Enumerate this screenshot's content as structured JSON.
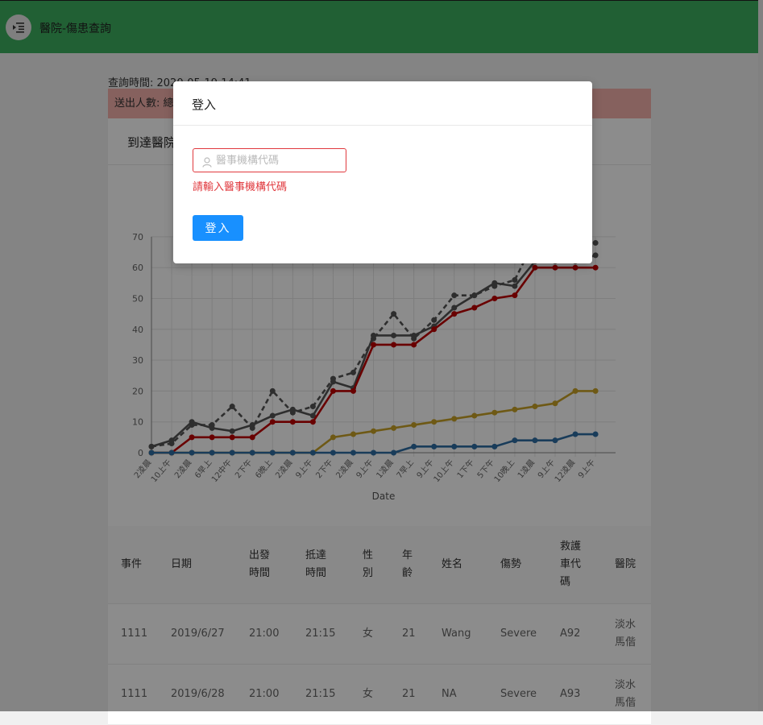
{
  "header": {
    "title": "醫院-傷患查詢",
    "menu_icon": "menu-fold-icon"
  },
  "query_time": "查詢時間: 2020-05-19 14:41",
  "banner": {
    "text": "送出人數: 總",
    "color": "#f5b1ab"
  },
  "card": {
    "title": "到達醫院"
  },
  "chart_data": {
    "type": "line",
    "xlabel": "Date",
    "ylabel": "",
    "ylim": [
      0,
      70
    ],
    "yticks": [
      0,
      10,
      20,
      30,
      40,
      50,
      60,
      70
    ],
    "x": [
      "2凌晨",
      "10上午",
      "2凌晨",
      "6早上",
      "12中午",
      "2下午",
      "6晚上",
      "2凌晨",
      "9上午",
      "2下午",
      "2凌晨",
      "9上午",
      "1凌晨",
      "7早上",
      "9上午",
      "10上午",
      "1下午",
      "5下午",
      "10晚上",
      "1凌晨",
      "9上午",
      "12凌晨",
      "9上午"
    ],
    "grid": true,
    "series": [
      {
        "style": "dashed",
        "color": "#555555",
        "values": [
          2,
          3,
          9,
          9,
          15,
          8,
          20,
          13,
          15,
          24,
          26,
          37,
          45,
          37,
          43,
          51,
          51,
          54,
          56,
          69,
          69,
          69,
          68
        ]
      },
      {
        "style": "solid",
        "color": "#555555",
        "values": [
          2,
          4,
          10,
          8,
          7,
          9,
          12,
          14,
          12,
          23,
          21,
          38,
          38,
          38,
          41,
          47,
          51,
          55,
          54,
          62,
          62,
          62,
          64
        ]
      },
      {
        "style": "solid",
        "color": "#c00000",
        "values": [
          0,
          0,
          5,
          5,
          5,
          5,
          10,
          10,
          10,
          20,
          20,
          35,
          35,
          35,
          40,
          45,
          47,
          50,
          51,
          60,
          60,
          60,
          60
        ]
      },
      {
        "style": "solid",
        "color": "#c9a227",
        "values": [
          0,
          0,
          0,
          0,
          0,
          0,
          0,
          0,
          0,
          5,
          6,
          7,
          8,
          9,
          10,
          11,
          12,
          13,
          14,
          15,
          16,
          20,
          20
        ]
      },
      {
        "style": "solid",
        "color": "#2e6da4",
        "values": [
          0,
          0,
          0,
          0,
          0,
          0,
          0,
          0,
          0,
          0,
          0,
          0,
          0,
          2,
          2,
          2,
          2,
          2,
          4,
          4,
          4,
          6,
          6
        ]
      }
    ]
  },
  "table": {
    "headers": [
      "事件",
      "日期",
      "出發\n時間",
      "抵達\n時間",
      "性\n別",
      "年\n齡",
      "姓名",
      "傷勢",
      "救護\n車代\n碼",
      "醫院"
    ],
    "rows": [
      [
        "1111",
        "2019/6/27",
        "21:00",
        "21:15",
        "女",
        "21",
        "Wang",
        "Severe",
        "A92",
        "淡水\n馬偕"
      ],
      [
        "1111",
        "2019/6/28",
        "21:00",
        "21:15",
        "女",
        "21",
        "NA",
        "Severe",
        "A93",
        "淡水\n馬偕"
      ]
    ]
  },
  "modal": {
    "title": "登入",
    "input_placeholder": "醫事機構代碼",
    "input_value": "",
    "input_icon": "user-icon",
    "error": "請輸入醫事機構代碼",
    "button_label": "登入",
    "button_color": "#1890ff",
    "error_color": "#e0393e"
  }
}
